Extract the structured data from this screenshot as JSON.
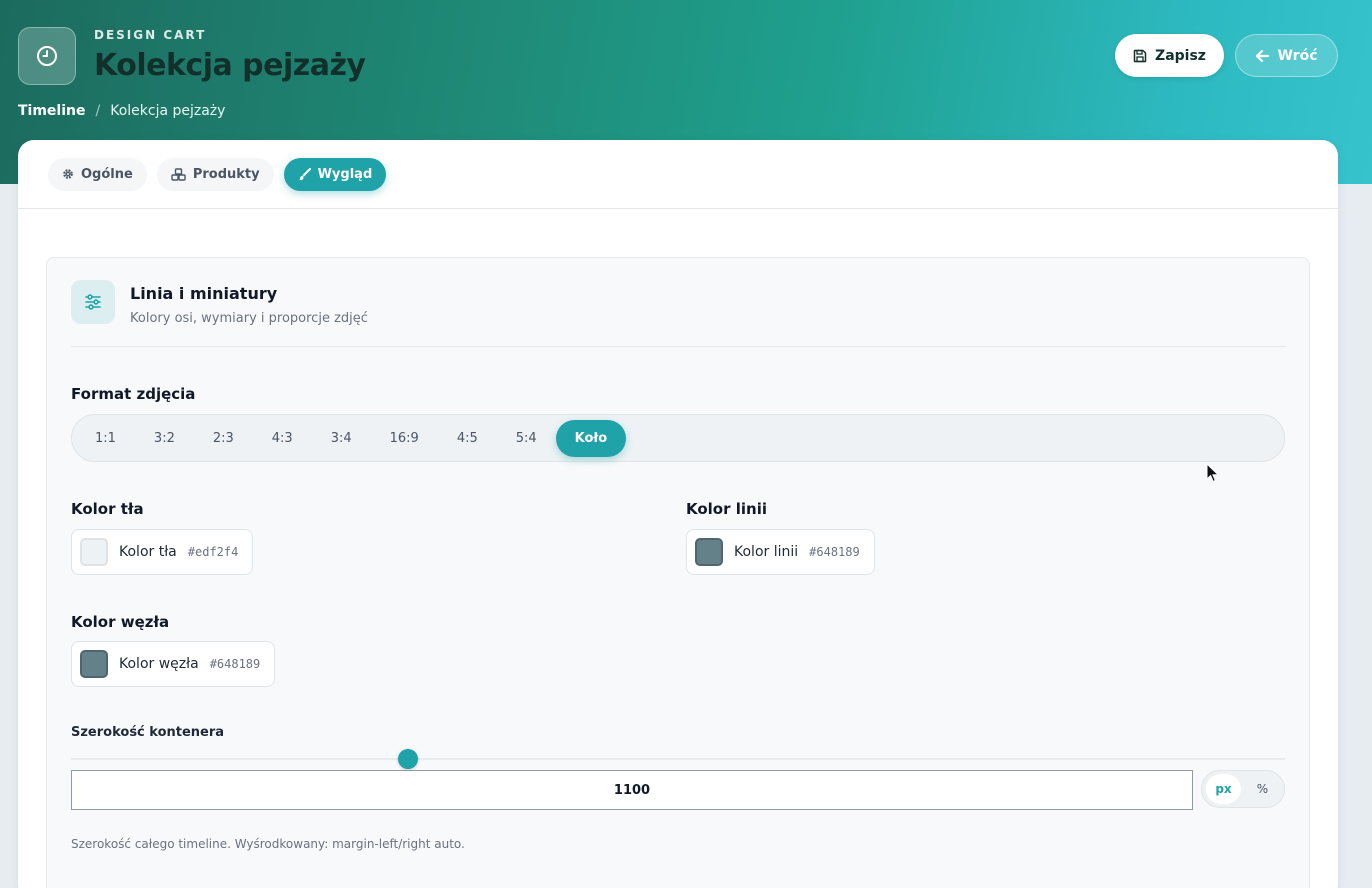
{
  "header": {
    "kicker": "DESIGN CART",
    "title": "Kolekcja pejzaży",
    "breadcrumb": {
      "root": "Timeline",
      "separator": "/",
      "current": "Kolekcja pejzaży"
    },
    "save_label": "Zapisz",
    "back_label": "Wróć"
  },
  "tabs": [
    {
      "label": "Ogólne",
      "icon": "gear-icon",
      "active": false
    },
    {
      "label": "Produkty",
      "icon": "cubes-icon",
      "active": false
    },
    {
      "label": "Wygląd",
      "icon": "brush-icon",
      "active": true
    }
  ],
  "section": {
    "title": "Linia i miniatury",
    "subtitle": "Kolory osi, wymiary i proporcje zdjęć",
    "icon": "sliders-icon"
  },
  "format": {
    "label": "Format zdjęcia",
    "options": [
      "1:1",
      "3:2",
      "2:3",
      "4:3",
      "3:4",
      "16:9",
      "4:5",
      "5:4",
      "Koło"
    ],
    "selected": "Koło"
  },
  "colors": {
    "background": {
      "label": "Kolor tła",
      "name": "Kolor tła",
      "hex": "#edf2f4"
    },
    "line": {
      "label": "Kolor linii",
      "name": "Kolor linii",
      "hex": "#648189"
    },
    "node": {
      "label": "Kolor węzła",
      "name": "Kolor węzła",
      "hex": "#648189"
    }
  },
  "container_width": {
    "label": "Szerokość kontenera",
    "value": "1100",
    "slider_fraction": 0.278,
    "units": [
      "px",
      "%"
    ],
    "selected_unit": "px",
    "hint": "Szerokość całego timeline. Wyśrodkowany: margin-left/right auto."
  },
  "accent_color": "#1fa3a9"
}
